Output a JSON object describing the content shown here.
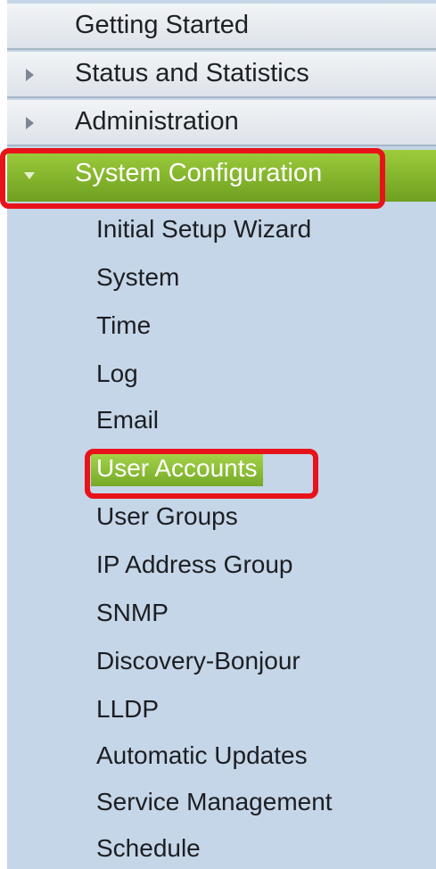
{
  "sidebar": {
    "top_items": [
      {
        "label": "Getting Started",
        "has_arrow": false
      },
      {
        "label": "Status and Statistics",
        "has_arrow": true
      },
      {
        "label": "Administration",
        "has_arrow": true
      }
    ],
    "active_section": {
      "label": "System Configuration",
      "expanded": true
    },
    "sub_items": [
      {
        "label": "Initial Setup Wizard"
      },
      {
        "label": "System"
      },
      {
        "label": "Time"
      },
      {
        "label": "Log"
      },
      {
        "label": "Email"
      },
      {
        "label": "User Accounts",
        "selected": true
      },
      {
        "label": "User Groups"
      },
      {
        "label": "IP Address Group"
      },
      {
        "label": "SNMP"
      },
      {
        "label": "Discovery-Bonjour"
      },
      {
        "label": "LLDP"
      },
      {
        "label": "Automatic Updates"
      },
      {
        "label": "Service Management"
      },
      {
        "label": "Schedule"
      }
    ]
  },
  "colors": {
    "sidebar_bg": "#c5d6e8",
    "active_green": "#7fb02a",
    "highlight_red": "#e8131a"
  }
}
